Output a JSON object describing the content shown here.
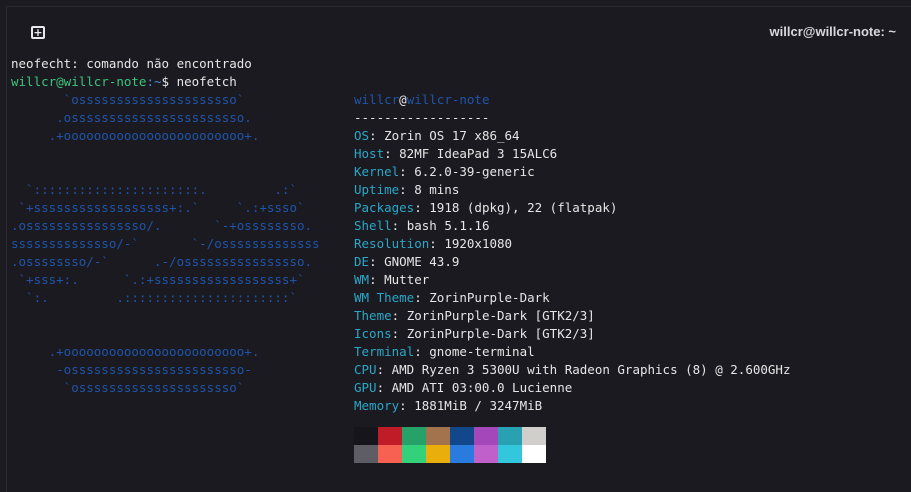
{
  "titlebar": {
    "title": "willcr@willcr-note: ~",
    "new_tab_glyph": "+"
  },
  "terminal": {
    "error_line": "neofecht: comando não encontrado",
    "prompt": {
      "user": "willcr@willcr-note",
      "path": ":~",
      "cmd": "$ neofetch"
    },
    "logo_lines": [
      "       `osssssssssssssssssssso`",
      "      .osssssssssssssssssssssso.",
      "     .+oooooooooooooooooooooooo+.",
      "",
      "",
      "  `::::::::::::::::::::::.         .:`",
      " `+ssssssssssssssssss+:.`     `.:+ssso`",
      ".ossssssssssssssso/.       `-+ossssssso.",
      "ssssssssssssso/-`       `-/osssssssssssss",
      ".ossssssso/-`      .-/ossssssssssssssso.",
      " `+sss+:.      `.:+ssssssssssssssssss+`",
      "  `:.         .::::::::::::::::::::::`",
      "",
      "",
      "     .+oooooooooooooooooooooooo+.",
      "      -osssssssssssssssssssssso-",
      "       `osssssssssssssssssssso`"
    ],
    "info": {
      "user": "willcr",
      "at": "@",
      "host": "willcr-note",
      "separator": "------------------",
      "rows": [
        {
          "key": "OS",
          "value": ": Zorin OS 17 x86_64"
        },
        {
          "key": "Host",
          "value": ": 82MF IdeaPad 3 15ALC6"
        },
        {
          "key": "Kernel",
          "value": ": 6.2.0-39-generic"
        },
        {
          "key": "Uptime",
          "value": ": 8 mins"
        },
        {
          "key": "Packages",
          "value": ": 1918 (dpkg), 22 (flatpak)"
        },
        {
          "key": "Shell",
          "value": ": bash 5.1.16"
        },
        {
          "key": "Resolution",
          "value": ": 1920x1080"
        },
        {
          "key": "DE",
          "value": ": GNOME 43.9"
        },
        {
          "key": "WM",
          "value": ": Mutter"
        },
        {
          "key": "WM Theme",
          "value": ": ZorinPurple-Dark"
        },
        {
          "key": "Theme",
          "value": ": ZorinPurple-Dark [GTK2/3]"
        },
        {
          "key": "Icons",
          "value": ": ZorinPurple-Dark [GTK2/3]"
        },
        {
          "key": "Terminal",
          "value": ": gnome-terminal"
        },
        {
          "key": "CPU",
          "value": ": AMD Ryzen 3 5300U with Radeon Graphics (8) @ 2.600GHz"
        },
        {
          "key": "GPU",
          "value": ": AMD ATI 03:00.0 Lucienne"
        },
        {
          "key": "Memory",
          "value": ": 1881MiB / 3247MiB"
        }
      ]
    },
    "palette": [
      "#16151b",
      "#c01c28",
      "#26a269",
      "#a2734c",
      "#12488b",
      "#a347ba",
      "#2aa1b3",
      "#d0cfcc",
      "#5e5c64",
      "#f66151",
      "#33d17a",
      "#e9ad0c",
      "#2a7bde",
      "#c061cb",
      "#33c7de",
      "#ffffff"
    ]
  }
}
